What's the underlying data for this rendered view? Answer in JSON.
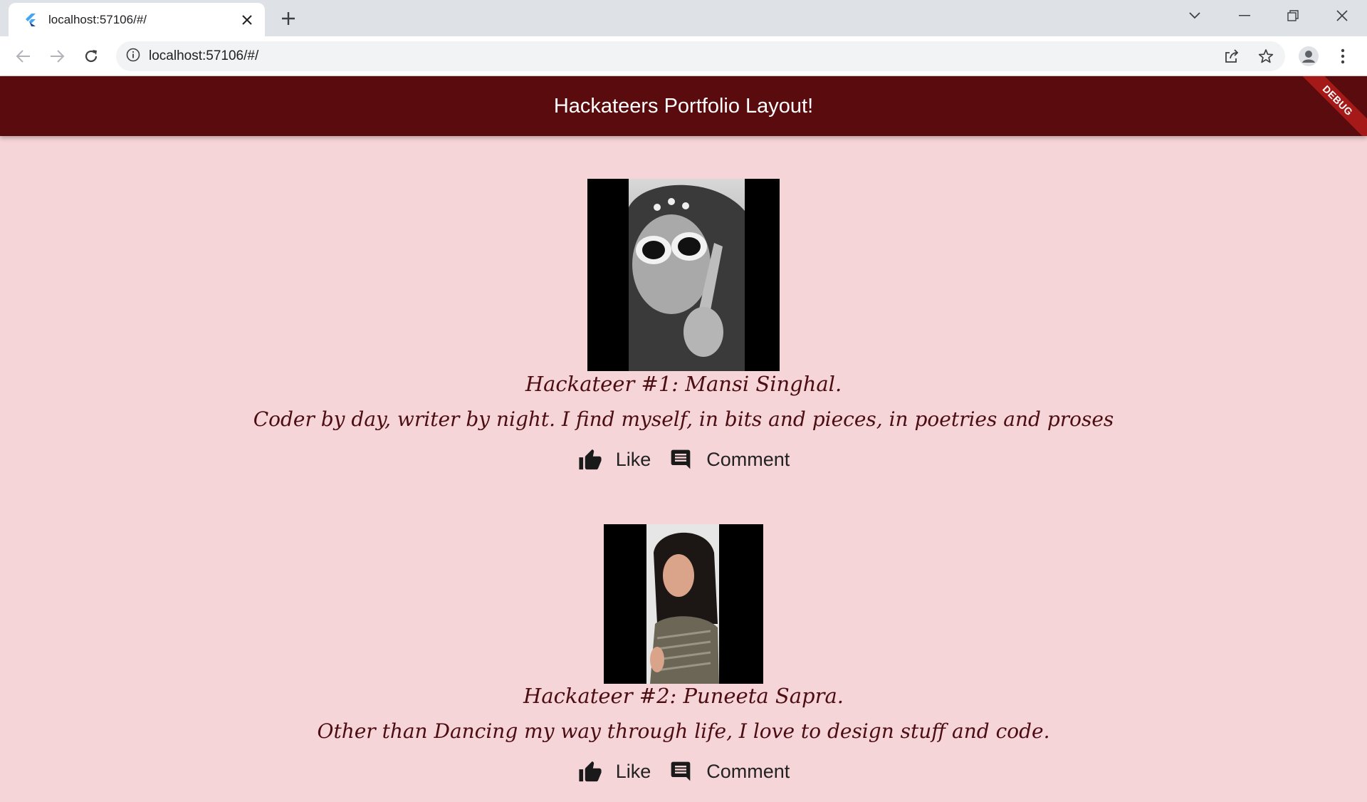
{
  "browser": {
    "tab_title": "localhost:57106/#/",
    "url": "localhost:57106/#/"
  },
  "app": {
    "title": "Hackateers Portfolio Layout!",
    "debug_label": "DEBUG",
    "appbar_color": "#5a0b0e",
    "background_color": "#f5d5d8"
  },
  "profiles": [
    {
      "title": "Hackateer #1: Mansi Singhal.",
      "description": "Coder by day, writer by night. I find myself, in bits and pieces, in poetries and proses",
      "like_label": "Like",
      "comment_label": "Comment"
    },
    {
      "title": "Hackateer #2: Puneeta Sapra.",
      "description": "Other than Dancing my way through life, I love to design stuff and code.",
      "like_label": "Like",
      "comment_label": "Comment"
    }
  ]
}
